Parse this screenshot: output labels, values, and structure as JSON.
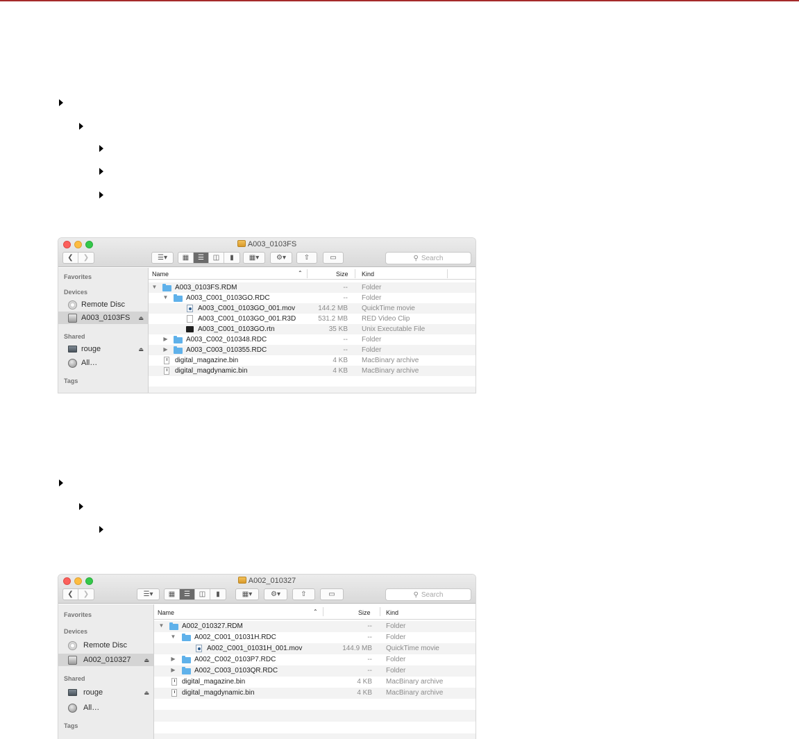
{
  "window1": {
    "title": "A003_0103FS",
    "search_placeholder": "Search",
    "sidebar": {
      "favorites": "Favorites",
      "devices": "Devices",
      "shared": "Shared",
      "tags": "Tags",
      "items": [
        {
          "label": "Remote Disc"
        },
        {
          "label": "A003_0103FS"
        },
        {
          "label": "rouge"
        },
        {
          "label": "All…"
        }
      ]
    },
    "columns": {
      "name": "Name",
      "size": "Size",
      "kind": "Kind"
    },
    "rows": [
      {
        "name": "A003_0103FS.RDM",
        "size": "--",
        "kind": "Folder"
      },
      {
        "name": "A003_C001_0103GO.RDC",
        "size": "--",
        "kind": "Folder"
      },
      {
        "name": "A003_C001_0103GO_001.mov",
        "size": "144.2 MB",
        "kind": "QuickTime movie"
      },
      {
        "name": "A003_C001_0103GO_001.R3D",
        "size": "531.2 MB",
        "kind": "RED Video Clip"
      },
      {
        "name": "A003_C001_0103GO.rtn",
        "size": "35 KB",
        "kind": "Unix Executable File"
      },
      {
        "name": "A003_C002_010348.RDC",
        "size": "--",
        "kind": "Folder"
      },
      {
        "name": "A003_C003_010355.RDC",
        "size": "--",
        "kind": "Folder"
      },
      {
        "name": "digital_magazine.bin",
        "size": "4 KB",
        "kind": "MacBinary archive"
      },
      {
        "name": "digital_magdynamic.bin",
        "size": "4 KB",
        "kind": "MacBinary archive"
      }
    ]
  },
  "window2": {
    "title": "A002_010327",
    "search_placeholder": "Search",
    "sidebar": {
      "favorites": "Favorites",
      "devices": "Devices",
      "shared": "Shared",
      "tags": "Tags",
      "items": [
        {
          "label": "Remote Disc"
        },
        {
          "label": "A002_010327"
        },
        {
          "label": "rouge"
        },
        {
          "label": "All…"
        }
      ]
    },
    "columns": {
      "name": "Name",
      "size": "Size",
      "kind": "Kind"
    },
    "rows": [
      {
        "name": "A002_010327.RDM",
        "size": "--",
        "kind": "Folder"
      },
      {
        "name": "A002_C001_01031H.RDC",
        "size": "--",
        "kind": "Folder"
      },
      {
        "name": "A002_C001_01031H_001.mov",
        "size": "144.9 MB",
        "kind": "QuickTime movie"
      },
      {
        "name": "A002_C002_0103P7.RDC",
        "size": "--",
        "kind": "Folder"
      },
      {
        "name": "A002_C003_0103QR.RDC",
        "size": "--",
        "kind": "Folder"
      },
      {
        "name": "digital_magazine.bin",
        "size": "4 KB",
        "kind": "MacBinary archive"
      },
      {
        "name": "digital_magdynamic.bin",
        "size": "4 KB",
        "kind": "MacBinary archive"
      }
    ]
  }
}
